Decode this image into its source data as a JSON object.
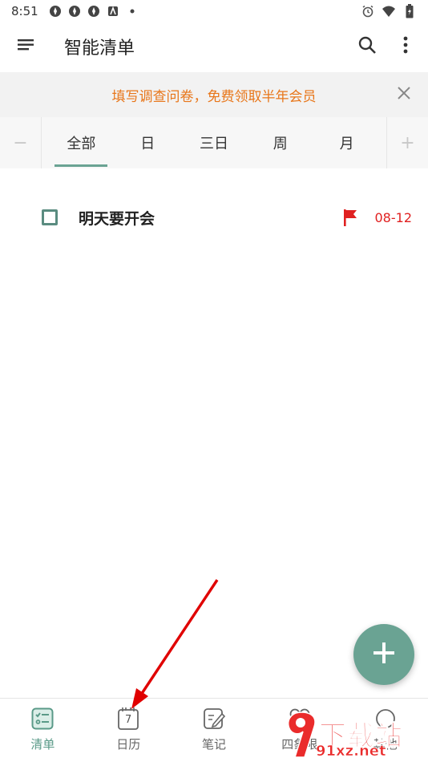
{
  "status_bar": {
    "time": "8:51",
    "icons": [
      "app-icon",
      "app-icon",
      "app-icon",
      "app-icon",
      "dot-icon"
    ],
    "right_icons": [
      "alarm-icon",
      "wifi-icon",
      "battery-icon"
    ]
  },
  "app_bar": {
    "title": "智能清单",
    "menu_icon": "menu-icon",
    "search_icon": "search-icon",
    "more_icon": "more-vert-icon"
  },
  "banner": {
    "text": "填写调查问卷，免费领取半年会员",
    "close_icon": "close-icon"
  },
  "tabs": {
    "left_edge": "−",
    "right_edge": "+",
    "items": [
      {
        "label": "全部",
        "active": true
      },
      {
        "label": "日"
      },
      {
        "label": "三日"
      },
      {
        "label": "周"
      },
      {
        "label": "月"
      }
    ]
  },
  "tasks": [
    {
      "title": "明天要开会",
      "date": "08-12",
      "flag_color": "#e02020"
    }
  ],
  "fab": {
    "icon": "plus-icon"
  },
  "bottom_nav": {
    "items": [
      {
        "label": "清单",
        "icon": "checklist-icon",
        "active": true
      },
      {
        "label": "日历",
        "icon": "calendar-icon",
        "calendar_day": "7"
      },
      {
        "label": "笔记",
        "icon": "note-edit-icon"
      },
      {
        "label": "四象限",
        "icon": "quadrant-icon"
      },
      {
        "label": "其他",
        "icon": "other-icon"
      }
    ]
  },
  "watermark": {
    "text": "下载站",
    "domain": "91xz.net"
  },
  "colors": {
    "accent": "#6aa393",
    "banner_text": "#e8761a",
    "date_red": "#e02020"
  }
}
